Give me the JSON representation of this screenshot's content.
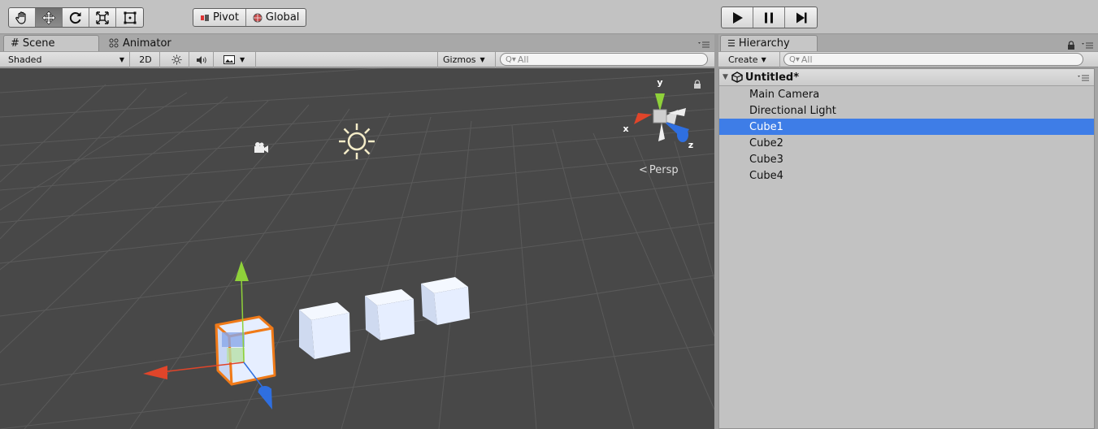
{
  "toolbar": {
    "tools": [
      "hand-icon",
      "move-icon",
      "rotate-icon",
      "scale-icon",
      "rect-icon"
    ],
    "pivot_label": "Pivot",
    "global_label": "Global",
    "play_controls": [
      "play-icon",
      "pause-icon",
      "step-icon"
    ]
  },
  "scene_panel": {
    "tabs": [
      {
        "label": "Scene",
        "icon": "grid-icon",
        "active": true
      },
      {
        "label": "Animator",
        "icon": "animator-icon",
        "active": false
      }
    ],
    "shading_mode": "Shaded",
    "mode_2d_label": "2D",
    "gizmos_label": "Gizmos",
    "search_placeholder": "All",
    "view_label": "Persp",
    "axis_labels": {
      "x": "x",
      "y": "y",
      "z": "z"
    }
  },
  "hierarchy_panel": {
    "tab_label": "Hierarchy",
    "create_label": "Create",
    "search_placeholder": "All",
    "scene_name": "Untitled*",
    "items": [
      {
        "label": "Main Camera",
        "selected": false
      },
      {
        "label": "Directional Light",
        "selected": false
      },
      {
        "label": "Cube1",
        "selected": true
      },
      {
        "label": "Cube2",
        "selected": false
      },
      {
        "label": "Cube3",
        "selected": false
      },
      {
        "label": "Cube4",
        "selected": false
      }
    ]
  },
  "colors": {
    "selection": "#3e7de7",
    "scene_bg": "#484848",
    "selected_outline": "#f07a18",
    "axis_x": "#e0452a",
    "axis_y": "#8fd13a",
    "axis_z": "#2f6fe0"
  }
}
